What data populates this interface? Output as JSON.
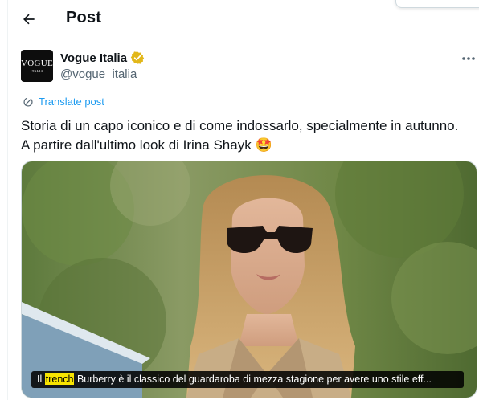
{
  "header": {
    "title": "Post"
  },
  "author": {
    "name": "Vogue Italia",
    "handle": "@vogue_italia",
    "avatar_text": "VOGUE",
    "avatar_subtext": "ITALIA"
  },
  "translate_label": "Translate post",
  "post": {
    "line1": "Storia di un capo iconico e di come indossarlo, specialmente in autunno.",
    "line2": "A partire dall'ultimo look di Irina Shayk",
    "emoji": "🤩"
  },
  "media": {
    "caption_before": "Il ",
    "caption_highlight": "trench",
    "caption_after": " Burberry è il classico del guardaroba di mezza stagione per avere uno stile eff..."
  },
  "colors": {
    "accent": "#1d9bf0",
    "verified": "#e2b719",
    "text": "#0f1419",
    "muted": "#536471"
  },
  "icons": [
    "back-arrow-icon",
    "verified-badge-icon",
    "more-icon",
    "translate-icon"
  ]
}
